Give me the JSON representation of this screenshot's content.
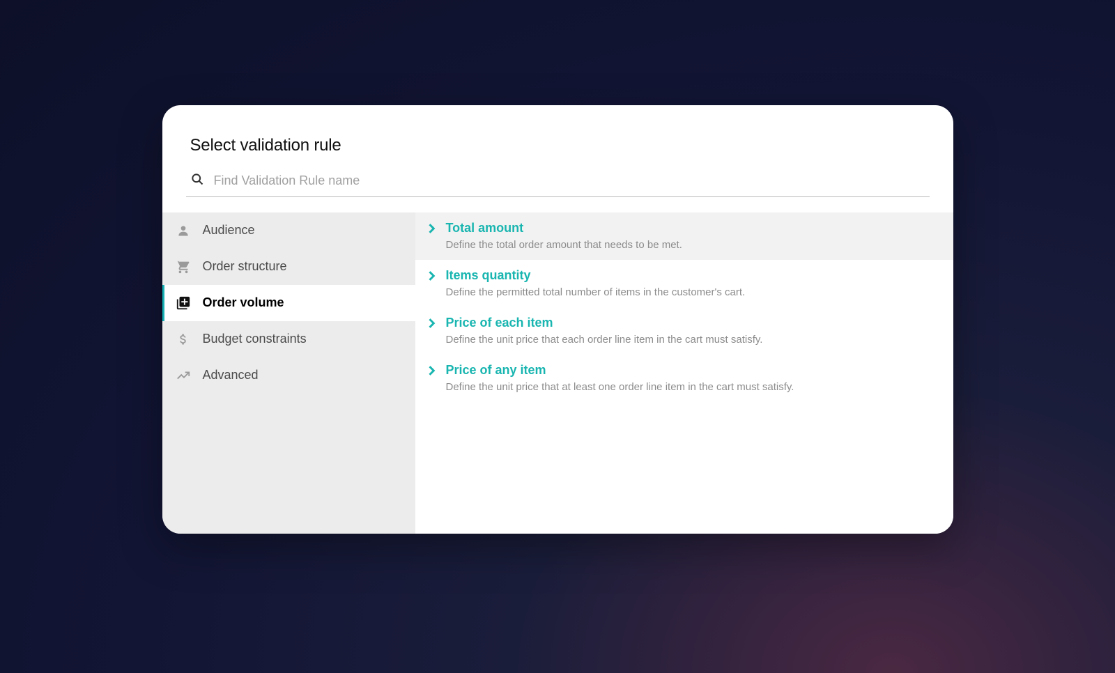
{
  "header": {
    "title": "Select validation rule"
  },
  "search": {
    "placeholder": "Find Validation Rule name"
  },
  "sidebar": {
    "items": [
      {
        "label": "Audience"
      },
      {
        "label": "Order structure"
      },
      {
        "label": "Order volume"
      },
      {
        "label": "Budget constraints"
      },
      {
        "label": "Advanced"
      }
    ]
  },
  "rules": [
    {
      "title": "Total amount",
      "desc": "Define the total order amount that needs to be met."
    },
    {
      "title": "Items quantity",
      "desc": "Define the permitted total number of items in the customer's cart."
    },
    {
      "title": "Price of each item",
      "desc": "Define the unit price that each order line item in the cart must satisfy."
    },
    {
      "title": "Price of any item",
      "desc": "Define the unit price that at least one order line item in the cart must satisfy."
    }
  ]
}
